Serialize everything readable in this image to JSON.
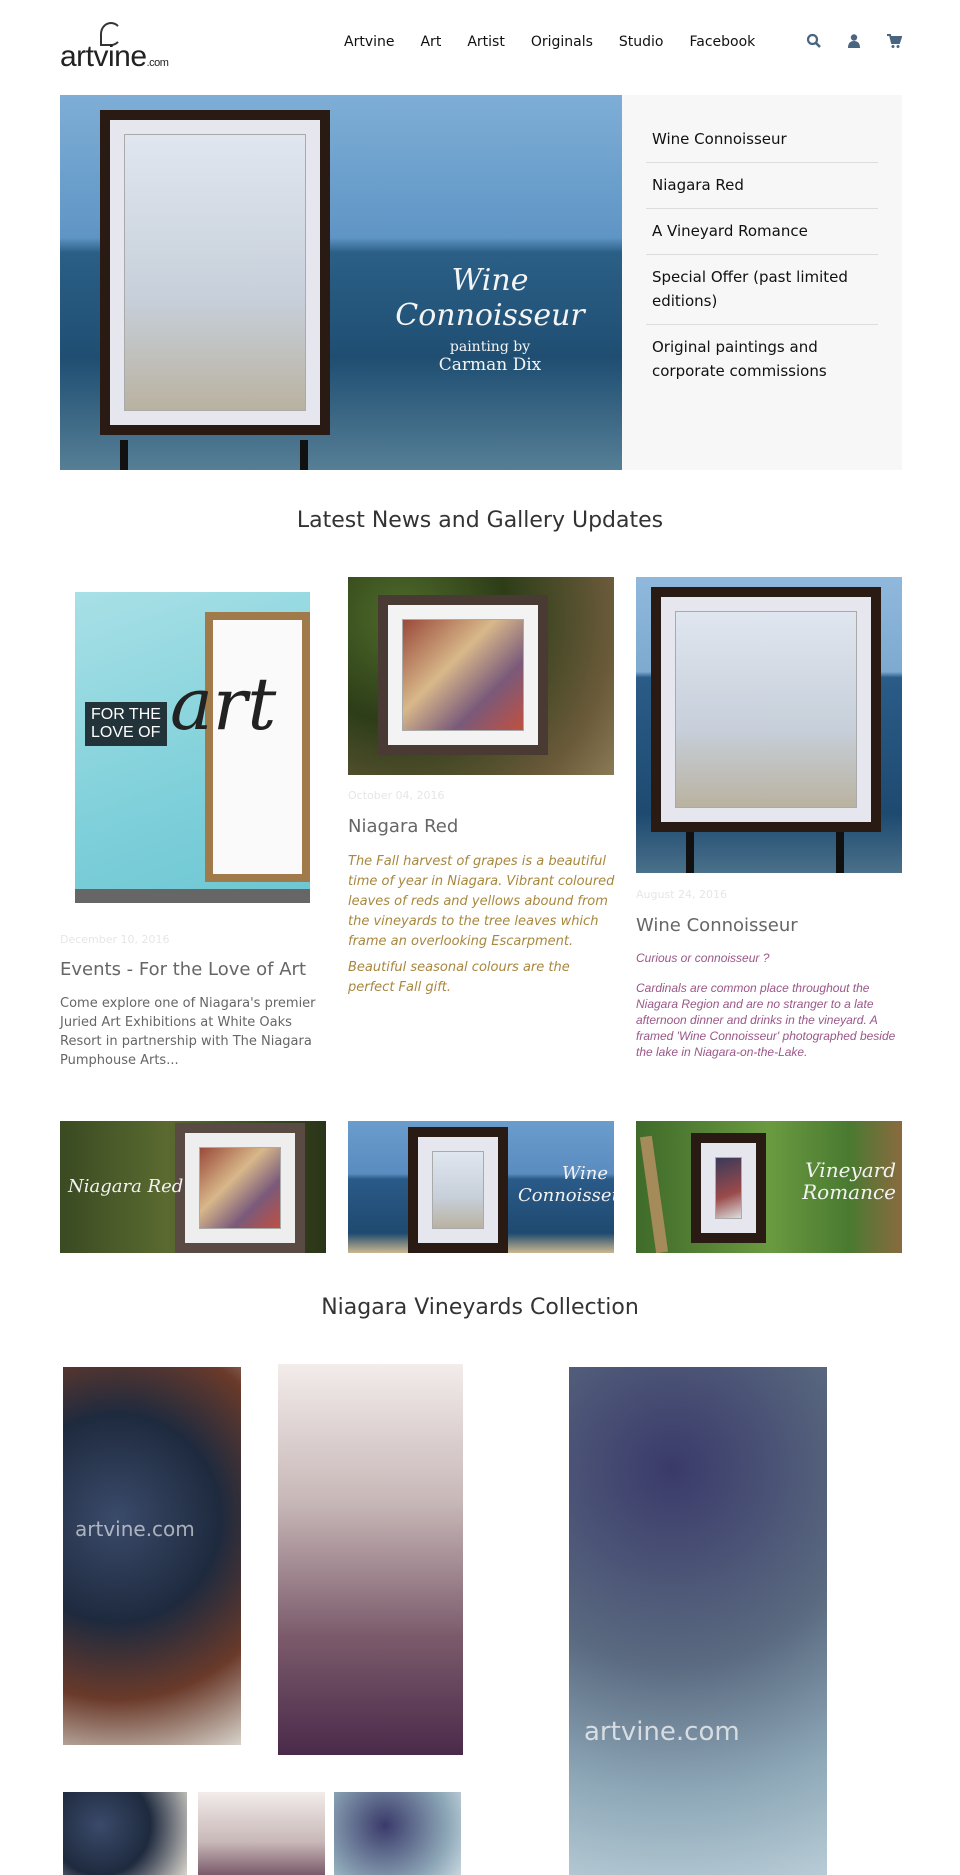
{
  "header": {
    "logo_text": "artvine",
    "logo_suffix": ".com",
    "nav": [
      {
        "label": "Artvine"
      },
      {
        "label": "Art"
      },
      {
        "label": "Artist"
      },
      {
        "label": "Originals"
      },
      {
        "label": "Studio"
      },
      {
        "label": "Facebook"
      }
    ],
    "icons": {
      "search": "search-icon",
      "account": "user-icon",
      "cart": "cart-icon"
    },
    "icon_color": "#4a6580"
  },
  "hero": {
    "title": "Wine Connoisseur",
    "subtitle": "painting by",
    "artist": "Carman Dix",
    "menu": [
      {
        "label": "Wine Connoisseur"
      },
      {
        "label": "Niagara Red"
      },
      {
        "label": "A Vineyard Romance"
      },
      {
        "label": "Special Offer (past limited editions)"
      },
      {
        "label": "Original paintings and corporate commissions"
      }
    ]
  },
  "news": {
    "heading": "Latest News and Gallery Updates",
    "cards": [
      {
        "date": "December 10, 2016",
        "title": "Events - For the Love of Art",
        "text": "Come explore one of Niagara's premier Juried Art Exhibitions at White Oaks Resort in partnership with The Niagara Pumphouse Arts...",
        "poster": {
          "l1": "FOR THE",
          "l2": "LOVE OF",
          "big": "art"
        }
      },
      {
        "date": "October 04, 2016",
        "title": "Niagara Red",
        "paras": [
          "The Fall harvest of grapes is a beautiful time of year in Niagara.  Vibrant coloured leaves of reds and yellows abound from the vineyards to the tree leaves which frame an overlooking Escarpment.",
          "Beautiful seasonal colours are the perfect Fall gift."
        ]
      },
      {
        "date": "August 24, 2016",
        "title": "Wine Connoisseur",
        "paras": [
          "Curious or connoisseur ?",
          "Cardinals are common place throughout the Niagara Region and are no stranger to a late afternoon dinner and drinks in the vineyard.  A framed 'Wine Connoisseur' photographed beside the lake in Niagara-on-the-Lake."
        ]
      }
    ]
  },
  "banners": [
    {
      "label": "Niagara Red"
    },
    {
      "label": "Wine Connoisseur"
    },
    {
      "label": "Vineyard Romance"
    }
  ],
  "collection": {
    "heading": "Niagara Vineyards Collection",
    "watermark": "artvine.com"
  },
  "colors": {
    "gold_text": "#a8873e",
    "purple_text": "#9a5688",
    "sidebar_bg": "#f7f7f7"
  }
}
